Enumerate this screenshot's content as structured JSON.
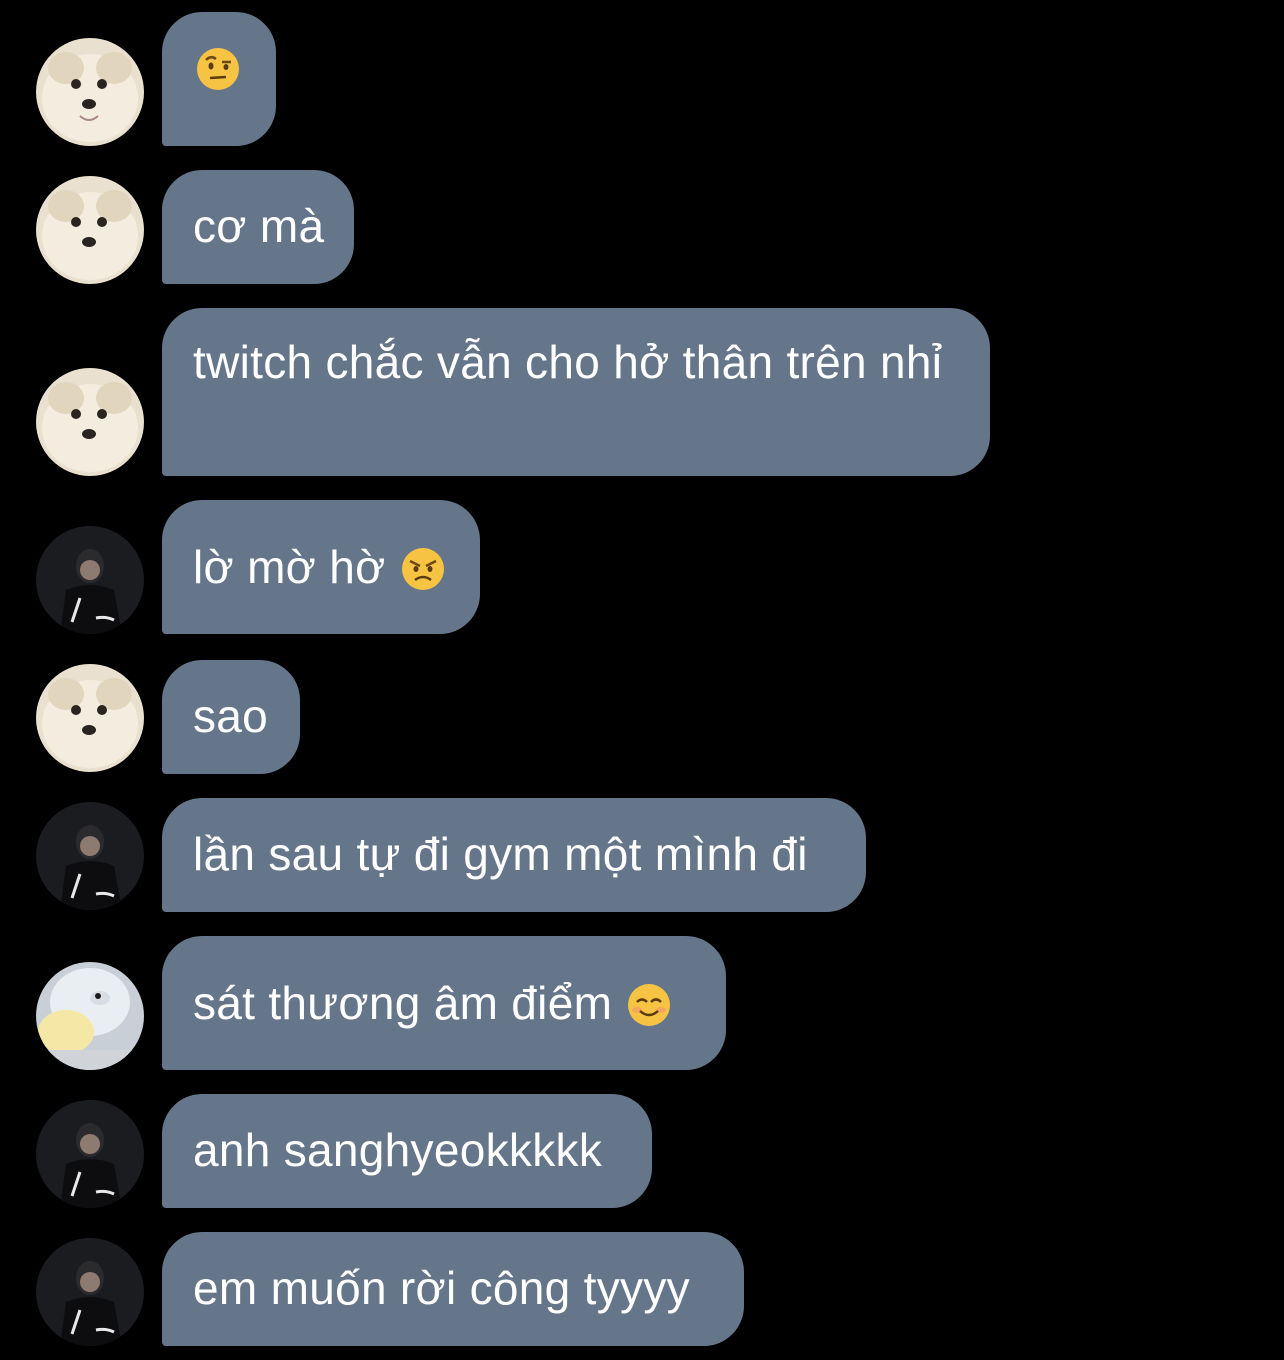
{
  "colors": {
    "background": "#000000",
    "bubble": "#66768a",
    "text": "#ffffff"
  },
  "messages": [
    {
      "sender": "dog-avatar",
      "emoji": "face-with-raised-eyebrow-emoji",
      "text": ""
    },
    {
      "sender": "dog-avatar",
      "text": "cơ mà"
    },
    {
      "sender": "dog-avatar",
      "text": "twitch chắc vẫn cho hở thân trên nhỉ"
    },
    {
      "sender": "man-avatar",
      "text": "lờ mờ hờ",
      "emoji": "angry-face-emoji"
    },
    {
      "sender": "dog-avatar",
      "text": "sao"
    },
    {
      "sender": "man-avatar",
      "text": "lần sau tự đi gym một mình đi"
    },
    {
      "sender": "penguin-avatar",
      "text": "sát thương âm điểm",
      "emoji": "smiling-face-emoji"
    },
    {
      "sender": "man-avatar",
      "text": "anh sanghyeokkkkk"
    },
    {
      "sender": "man-avatar",
      "text": "em muốn rời công tyyyy"
    }
  ]
}
